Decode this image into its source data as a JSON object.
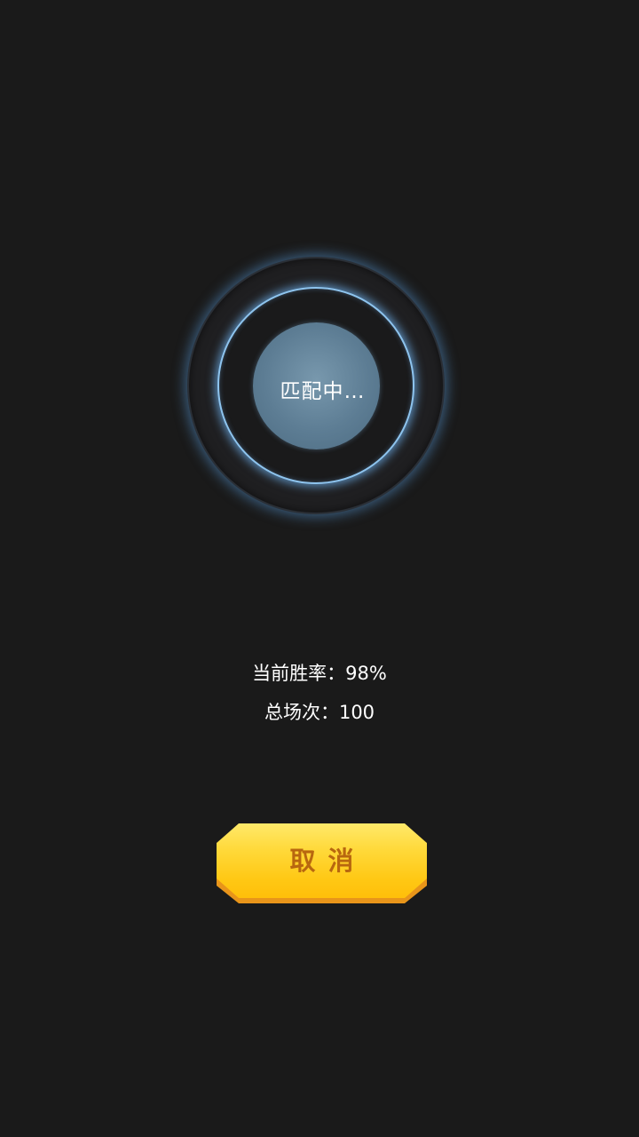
{
  "matching": {
    "status_text": "匹配中…"
  },
  "stats": {
    "win_rate_label": "当前胜率：",
    "win_rate_value": "98%",
    "total_label": "总场次：",
    "total_value": "100"
  },
  "cancel_button": {
    "label": "取消"
  },
  "colors": {
    "background": "#1a1a1a",
    "ring_glow": "#8ec4ee",
    "core": "#5d7d94",
    "button_yellow": "#ffd93a",
    "button_text": "#b8670f"
  }
}
